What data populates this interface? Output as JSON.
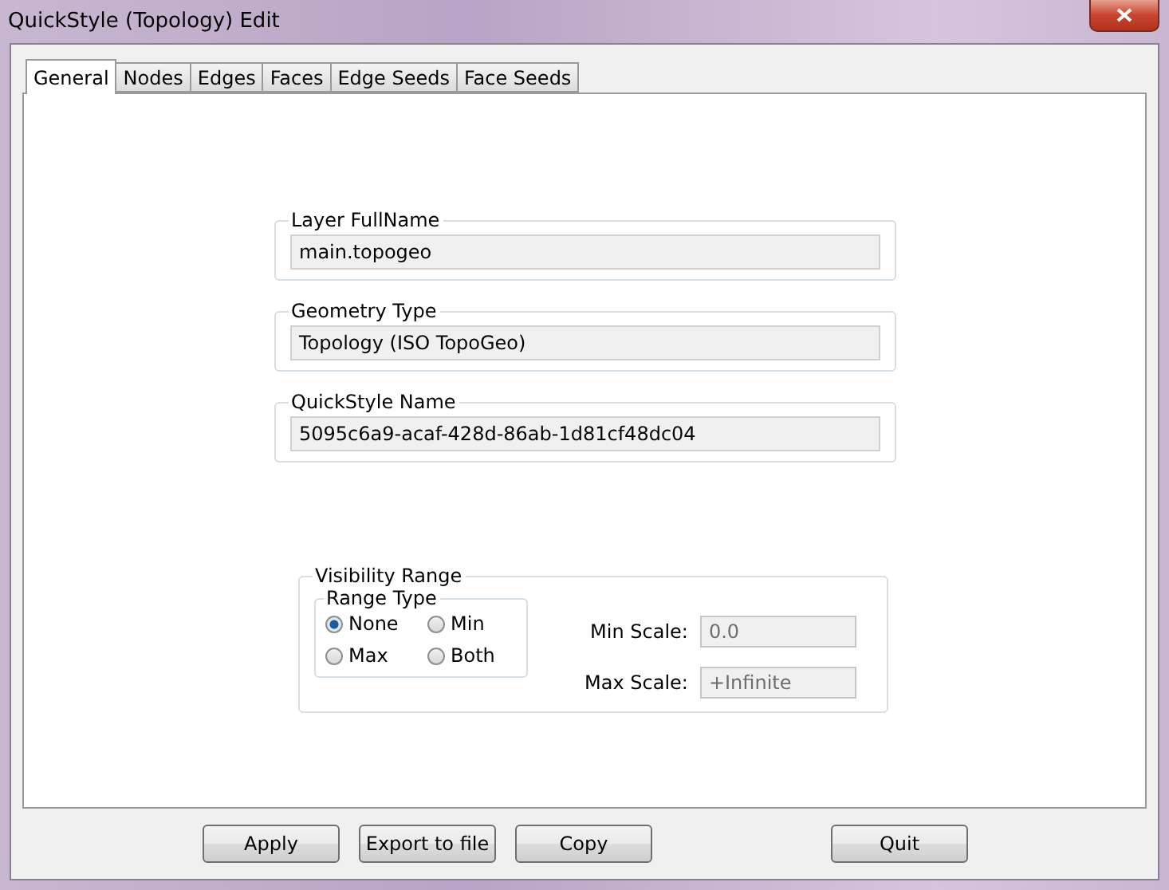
{
  "window": {
    "title": "QuickStyle (Topology) Edit"
  },
  "tabs": [
    {
      "label": "General",
      "selected": true
    },
    {
      "label": "Nodes",
      "selected": false
    },
    {
      "label": "Edges",
      "selected": false
    },
    {
      "label": "Faces",
      "selected": false
    },
    {
      "label": "Edge Seeds",
      "selected": false
    },
    {
      "label": "Face Seeds",
      "selected": false
    }
  ],
  "fields": [
    {
      "label": "Layer FullName",
      "value": "main.topogeo"
    },
    {
      "label": "Geometry Type",
      "value": "Topology (ISO TopoGeo)"
    },
    {
      "label": "QuickStyle Name",
      "value": "5095c6a9-acaf-428d-86ab-1d81cf48dc04"
    }
  ],
  "visibility_range": {
    "title": "Visibility Range",
    "range_type": {
      "title": "Range Type",
      "options": [
        {
          "label": "None",
          "selected": true
        },
        {
          "label": "Min",
          "selected": false
        },
        {
          "label": "Max",
          "selected": false
        },
        {
          "label": "Both",
          "selected": false
        }
      ]
    },
    "scales": [
      {
        "label": "Min Scale:",
        "value": "0.0"
      },
      {
        "label": "Max Scale:",
        "value": "+Infinite"
      }
    ]
  },
  "buttons": [
    "Apply",
    "Export to file",
    "Copy",
    "Quit"
  ]
}
